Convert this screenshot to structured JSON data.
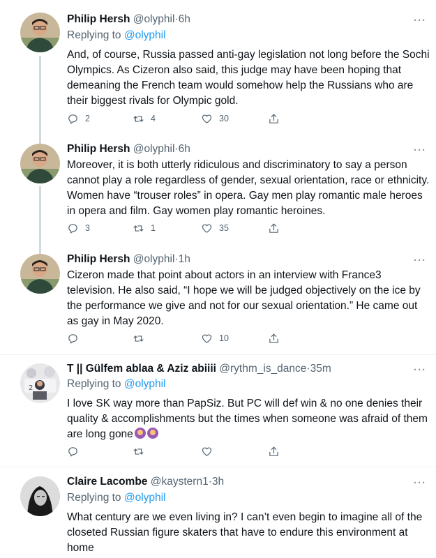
{
  "tweets": [
    {
      "name": "Philip Hersh",
      "handle": "@olyphil",
      "dot": "·",
      "time": "6h",
      "replying_prefix": "Replying to",
      "replying_to": "@olyphil",
      "text": "And, of course, Russia passed anti-gay legislation not long before the Sochi Olympics.  As Cizeron also said, this judge may have been hoping that demeaning the French team would somehow help the Russians who are their biggest rivals for Olympic gold.",
      "replies": "2",
      "retweets": "4",
      "likes": "30"
    },
    {
      "name": "Philip Hersh",
      "handle": "@olyphil",
      "dot": "·",
      "time": "6h",
      "text": "Moreover, it is both utterly ridiculous and discriminatory to say a person cannot play a role regardless of gender, sexual orientation, race or ethnicity.  Women have “trouser roles” in opera.  Gay men play romantic male heroes in opera and film. Gay women play romantic heroines.",
      "replies": "3",
      "retweets": "1",
      "likes": "35"
    },
    {
      "name": "Philip Hersh",
      "handle": "@olyphil",
      "dot": "·",
      "time": "1h",
      "text": "Cizeron made that point about actors in an interview with France3 television.  He also said, “I hope we will be judged objectively on the ice by the performance we give and not for our sexual orientation.” He came out as gay in May 2020.",
      "replies": "",
      "retweets": "",
      "likes": "10"
    },
    {
      "name": "T || Gülfem ablaa & Aziz abiiii",
      "handle": "@rythm_is_dance",
      "dot": "·",
      "time": "35m",
      "replying_prefix": "Replying to",
      "replying_to": "@olyphil",
      "text": "I love SK way more than PapSiz. But PC will def win & no one denies their quality & accomplishments but the times when someone was afraid of them are long gone",
      "replies": "",
      "retweets": "",
      "likes": ""
    },
    {
      "name": "Claire Lacombe",
      "handle": "@kaystern1",
      "dot": "·",
      "time": "3h",
      "replying_prefix": "Replying to",
      "replying_to": "@olyphil",
      "text": "What century are we even living in? I can’t even begin to imagine all of the closeted Russian figure skaters that have to endure this environment at home"
    }
  ],
  "icons": {
    "reply": "reply-icon",
    "retweet": "retweet-icon",
    "like": "heart-icon",
    "share": "share-icon",
    "more": "more-icon",
    "emoji": "woman-shrugging-emoji"
  },
  "colors": {
    "link": "#1d9bf0",
    "muted": "#536471",
    "text": "#0f1419",
    "separator": "#eff3f4",
    "thread_line": "#cfd9de"
  }
}
